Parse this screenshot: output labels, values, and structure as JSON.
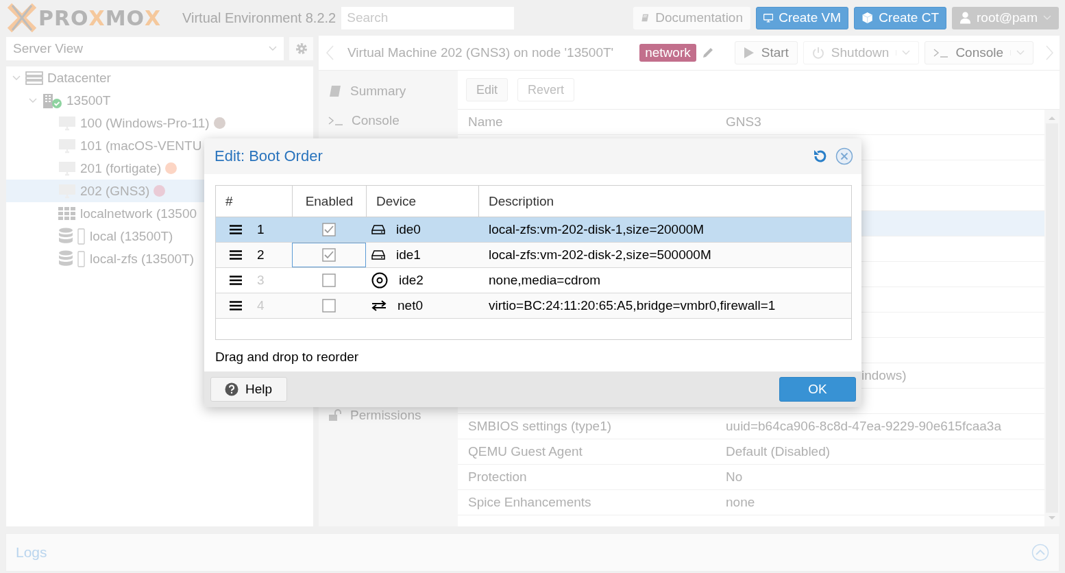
{
  "header": {
    "logo": "PRO**X**MO**X**",
    "product": "Virtual Environment 8.2.2",
    "search": {
      "placeholder": "Search"
    },
    "buttons": [
      {
        "label": "Documentation",
        "kind": "docs"
      },
      {
        "label": "Create VM",
        "kind": "vm"
      },
      {
        "label": "Create CT",
        "kind": "ct"
      },
      {
        "label": "root@pam",
        "kind": "user"
      }
    ]
  },
  "sidebar": {
    "view": "Server View",
    "tree": [
      {
        "label": "Datacenter",
        "kind": "datacenter",
        "expanded": true,
        "selected": false,
        "children": [
          {
            "label": "13500T",
            "kind": "node",
            "expanded": true,
            "selected": false,
            "children": [
              {
                "label": "100 (Windows-Pro-11)",
                "kind": "vm",
                "selected": false,
                "color": "#d9d0cd"
              },
              {
                "label": "101 (macOS-VENTU",
                "kind": "vm",
                "selected": false
              },
              {
                "label": "201 (fortigate)",
                "kind": "vm",
                "selected": false,
                "color": "#fcd5c4"
              },
              {
                "label": "202 (GNS3)",
                "kind": "vm",
                "selected": true,
                "color": "#eacbd6"
              },
              {
                "label": "localnetwork (13500",
                "kind": "sdn",
                "selected": false
              },
              {
                "label": "local (13500T)",
                "kind": "storage",
                "selected": false
              },
              {
                "label": "local-zfs (13500T)",
                "kind": "storage",
                "selected": false
              }
            ]
          }
        ]
      }
    ]
  },
  "vm_panel": {
    "title": "Virtual Machine 202 (GNS3) on node '13500T'",
    "tag": "network",
    "actions": [
      {
        "label": "Start",
        "kind": "start",
        "disabled": false,
        "split": false
      },
      {
        "label": "Shutdown",
        "kind": "shutdown",
        "disabled": true,
        "split": true
      },
      {
        "label": "Console",
        "kind": "console",
        "disabled": false,
        "split": true
      }
    ],
    "menu": {
      "items": [
        {
          "label": "Summary",
          "kind": "summary"
        },
        {
          "label": "Console",
          "kind": "console"
        }
      ],
      "bottom_items": [
        {
          "label": "Permissions",
          "kind": "permissions"
        }
      ]
    },
    "toolbar": [
      {
        "label": "Edit",
        "disabled": false
      },
      {
        "label": "Revert",
        "disabled": true
      }
    ],
    "rows": [
      {
        "name": "Name",
        "value": "GNS3",
        "selected": false
      },
      {
        "selected": false
      },
      {
        "selected": false
      },
      {
        "selected": false
      },
      {
        "selected": true
      },
      {
        "selected": false
      },
      {
        "selected": false
      },
      {
        "selected": false
      },
      {
        "selected": false
      },
      {
        "selected": false
      },
      {
        "value": "indows)",
        "selected": false
      },
      {
        "selected": false
      },
      {
        "name": "SMBIOS settings (type1)",
        "value": "uuid=b64ca906-8c8d-47ea-9229-90e615fcaa3a",
        "selected": false
      },
      {
        "name": "QEMU Guest Agent",
        "value": "Default (Disabled)",
        "selected": false
      },
      {
        "name": "Protection",
        "value": "No",
        "selected": false
      },
      {
        "name": "Spice Enhancements",
        "value": "none",
        "selected": false
      }
    ]
  },
  "dialog": {
    "title": "Edit: Boot Order",
    "columns": [
      "#",
      "Enabled",
      "Device",
      "Description"
    ],
    "rows": [
      {
        "order": "1",
        "enabled": true,
        "device": "ide0",
        "kind": "disk",
        "description": "local-zfs:vm-202-disk-1,size=20000M",
        "selected": true,
        "focused": false
      },
      {
        "order": "2",
        "enabled": true,
        "device": "ide1",
        "kind": "disk",
        "description": "local-zfs:vm-202-disk-2,size=500000M",
        "selected": false,
        "focused": true
      },
      {
        "order": "3",
        "enabled": false,
        "device": "ide2",
        "kind": "cdrom",
        "description": "none,media=cdrom",
        "selected": false,
        "focused": false
      },
      {
        "order": "4",
        "enabled": false,
        "device": "net0",
        "kind": "net",
        "description": "virtio=BC:24:11:20:65:A5,bridge=vmbr0,firewall=1",
        "selected": false,
        "focused": false
      }
    ],
    "hint": "Drag and drop to reorder",
    "help": "Help",
    "ok": "OK"
  },
  "logs": {
    "title": "Logs"
  }
}
